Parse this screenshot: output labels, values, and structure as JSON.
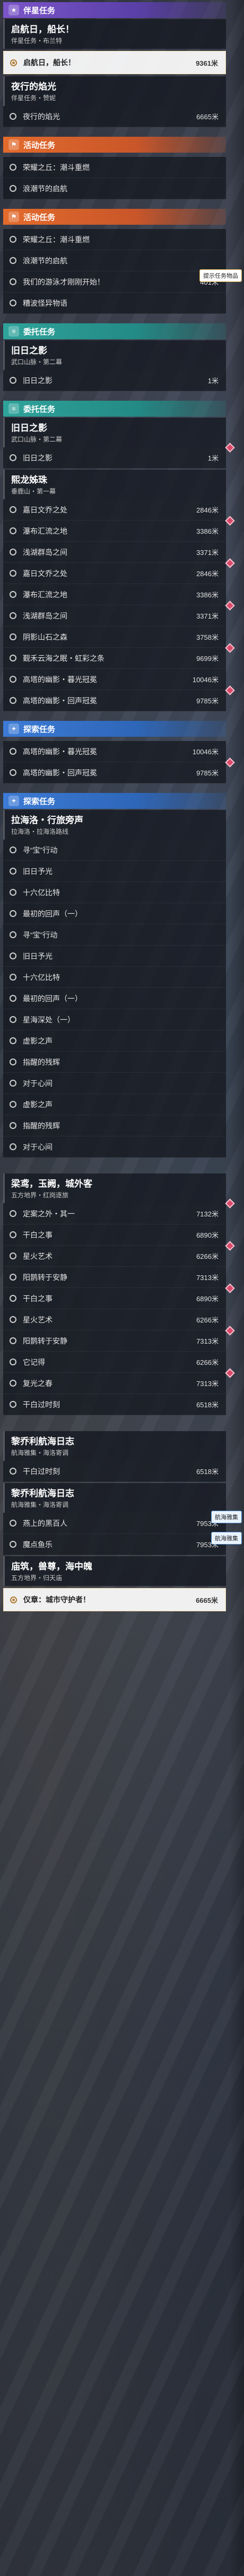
{
  "sections": [
    {
      "kind": "purple",
      "header": "伴星任务",
      "icon": "star-icon",
      "quests": [
        {
          "title": "启航日，船长！",
          "sub": "伴星任务・布兰特",
          "objectives": [
            {
              "text": "启航日，船长！",
              "dist": "9361米",
              "selected": true
            }
          ]
        },
        {
          "title": "夜行的焰光",
          "sub": "伴星任务・赞妮",
          "objectives": [
            {
              "text": "夜行的焰光",
              "dist": "6665米"
            }
          ]
        }
      ]
    },
    {
      "kind": "orange",
      "header": "活动任务",
      "icon": "flag-icon",
      "quests": [
        {
          "title": "",
          "sub": "",
          "objectives": [
            {
              "text": "荣耀之丘：潮斗重燃",
              "dist": ""
            },
            {
              "text": "浪潮节的启航",
              "dist": ""
            }
          ]
        }
      ]
    },
    {
      "kind": "orange",
      "header": "活动任务",
      "icon": "flag-icon",
      "quests": [
        {
          "title": "",
          "sub": "",
          "objectives": [
            {
              "text": "荣耀之丘：潮斗重燃",
              "dist": ""
            },
            {
              "text": "浪潮节的启航",
              "dist": ""
            },
            {
              "text": "我们的游泳才刚刚开始！",
              "dist": "401米",
              "badge": "提示任务物品"
            },
            {
              "text": "糟波怪异物语",
              "dist": ""
            }
          ]
        }
      ]
    },
    {
      "kind": "teal",
      "header": "委托任务",
      "icon": "scroll-icon",
      "quests": [
        {
          "title": "旧日之影",
          "sub": "武口山脉・第二幕",
          "objectives": [
            {
              "text": "旧日之影",
              "dist": "1米"
            }
          ]
        }
      ]
    },
    {
      "kind": "teal",
      "header": "委托任务",
      "icon": "scroll-icon",
      "quests": [
        {
          "title": "旧日之影",
          "sub": "武口山脉・第二幕",
          "objectives": [
            {
              "text": "旧日之影",
              "dist": "1米",
              "marker": true
            }
          ]
        },
        {
          "title": "熙龙姊珠",
          "sub": "垂鹿山・第一幕",
          "objectives": [
            {
              "text": "嘉日文乔之处",
              "dist": "2846米"
            },
            {
              "text": "瀑布汇流之地",
              "dist": "3386米",
              "marker": true
            },
            {
              "text": "浅湖群岛之间",
              "dist": "3371米"
            },
            {
              "text": "嘉日文乔之处",
              "dist": "2846米",
              "marker": true
            },
            {
              "text": "瀑布汇流之地",
              "dist": "3386米"
            },
            {
              "text": "浅湖群岛之间",
              "dist": "3371米",
              "marker": true
            },
            {
              "text": "阴影山石之森",
              "dist": "3758米"
            },
            {
              "text": "觐禾云海之眠・虹彩之条",
              "dist": "9699米",
              "marker": true
            },
            {
              "text": "高塔的幽影・暮光冠冕",
              "dist": "10046米"
            },
            {
              "text": "高塔的幽影・回声冠冕",
              "dist": "9785米",
              "marker": true
            }
          ]
        }
      ]
    },
    {
      "kind": "blue",
      "header": "探索任务",
      "icon": "compass-icon",
      "quests": [
        {
          "title": "",
          "sub": "",
          "objectives": [
            {
              "text": "高塔的幽影・暮光冠冕",
              "dist": "10046米"
            },
            {
              "text": "高塔的幽影・回声冠冕",
              "dist": "9785米",
              "marker": true
            }
          ]
        }
      ]
    },
    {
      "kind": "blue",
      "header": "探索任务",
      "icon": "compass-icon",
      "quests": [
        {
          "title": "拉海洛・行旅旁声",
          "sub": "拉海洛・拉海洛路线",
          "objectives": [
            {
              "text": "寻“宝”行动",
              "dist": ""
            },
            {
              "text": "旧日予光",
              "dist": ""
            },
            {
              "text": "十六亿比特",
              "dist": ""
            },
            {
              "text": "最初的回声（一）",
              "dist": ""
            },
            {
              "text": "寻“宝”行动",
              "dist": ""
            },
            {
              "text": "旧日予光",
              "dist": ""
            },
            {
              "text": "十六亿比特",
              "dist": ""
            },
            {
              "text": "最初的回声（一）",
              "dist": ""
            },
            {
              "text": "星海深处（一）",
              "dist": ""
            },
            {
              "text": "虚影之声",
              "dist": ""
            },
            {
              "text": "指醒的残辉",
              "dist": ""
            },
            {
              "text": "对于心间",
              "dist": ""
            },
            {
              "text": "虚影之声",
              "dist": ""
            },
            {
              "text": "指醒的残辉",
              "dist": ""
            },
            {
              "text": "对于心间",
              "dist": ""
            }
          ]
        }
      ]
    },
    {
      "kind": "none",
      "header": "",
      "icon": "",
      "quests": [
        {
          "title": "梁鸢，玉阙，城外客",
          "sub": "五方地界・红岗逐旅",
          "objectives": [
            {
              "text": "定案之外・其一",
              "dist": "7132米",
              "marker": true
            },
            {
              "text": "干白之事",
              "dist": "6890米"
            },
            {
              "text": "星火艺术",
              "dist": "6266米",
              "marker": true
            },
            {
              "text": "阳鹊转于安静",
              "dist": "7313米"
            },
            {
              "text": "干白之事",
              "dist": "6890米",
              "marker": true
            },
            {
              "text": "星火艺术",
              "dist": "6266米"
            },
            {
              "text": "阳鹊转于安静",
              "dist": "7313米",
              "marker": true
            },
            {
              "text": "它记得",
              "dist": "6266米"
            },
            {
              "text": "复光之春",
              "dist": "7313米",
              "marker": true
            },
            {
              "text": "干白过时刻",
              "dist": "6518米"
            }
          ]
        }
      ]
    },
    {
      "kind": "none",
      "header": "",
      "icon": "",
      "quests": [
        {
          "title": "黎乔利航海日志",
          "sub": "航海雅集・海洛寄调",
          "objectives": [
            {
              "text": "干白过时刻",
              "dist": "6518米"
            }
          ]
        },
        {
          "title": "黎乔利航海日志",
          "sub": "航海雅集・海洛寄调",
          "objectives": [
            {
              "text": "燕上的黑百人",
              "dist": "7953米",
              "badge": "航海雅集"
            },
            {
              "text": "魔点鱼乐",
              "dist": "7953米",
              "badge": "航海雅集"
            }
          ]
        },
        {
          "title": "庙筑，兽尊，海中魄",
          "sub": "五方地界・归天庙",
          "objectives": [
            {
              "text": "仪章：城市守护者！",
              "dist": "6665米",
              "selected": true
            }
          ]
        }
      ]
    }
  ]
}
